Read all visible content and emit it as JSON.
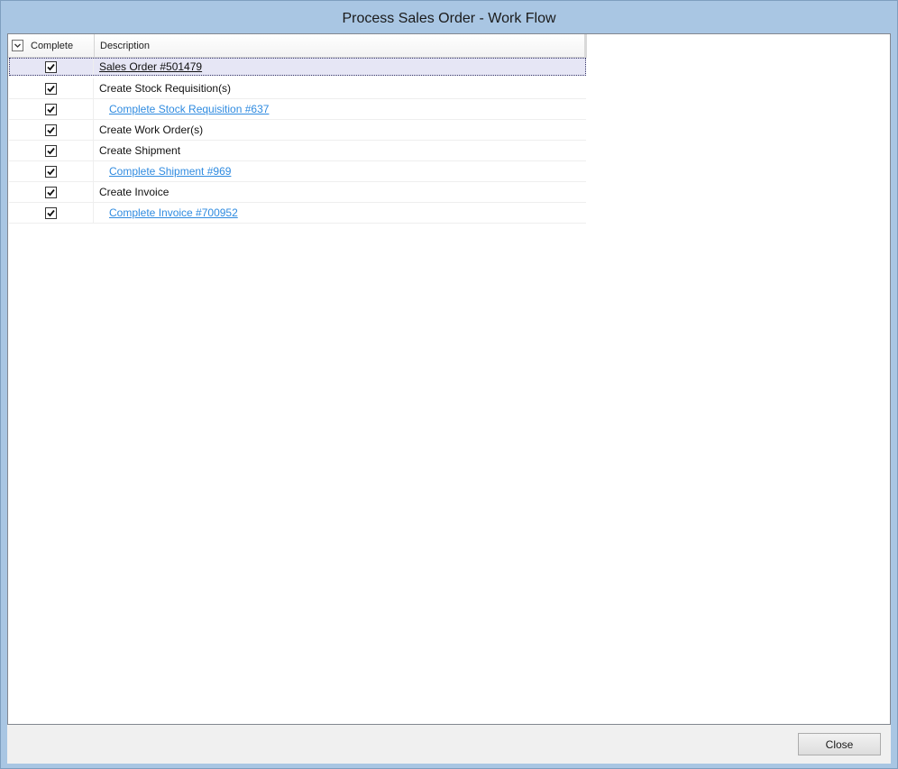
{
  "window": {
    "title": "Process Sales Order - Work Flow"
  },
  "grid": {
    "columns": {
      "complete": "Complete",
      "description": "Description"
    },
    "rows": [
      {
        "checked": true,
        "description": "Sales Order #501479",
        "style": "main-link",
        "selected": true
      },
      {
        "checked": true,
        "description": "Create Stock Requisition(s)",
        "style": "plain",
        "selected": false
      },
      {
        "checked": true,
        "description": "Complete Stock Requisition #637",
        "style": "link",
        "selected": false
      },
      {
        "checked": true,
        "description": "Create Work Order(s)",
        "style": "plain",
        "selected": false
      },
      {
        "checked": true,
        "description": "Create Shipment",
        "style": "plain",
        "selected": false
      },
      {
        "checked": true,
        "description": "Complete Shipment #969",
        "style": "link",
        "selected": false
      },
      {
        "checked": true,
        "description": "Create Invoice",
        "style": "plain",
        "selected": false
      },
      {
        "checked": true,
        "description": "Complete Invoice #700952",
        "style": "link",
        "selected": false
      }
    ]
  },
  "footer": {
    "close_label": "Close"
  },
  "colors": {
    "link": "#2f8be0",
    "selected_row": "#e6e6f5",
    "titlebar": "#a9c6e3"
  },
  "icons": {
    "header_toggle": "chevron-down-icon",
    "row_check": "checkmark-icon"
  }
}
